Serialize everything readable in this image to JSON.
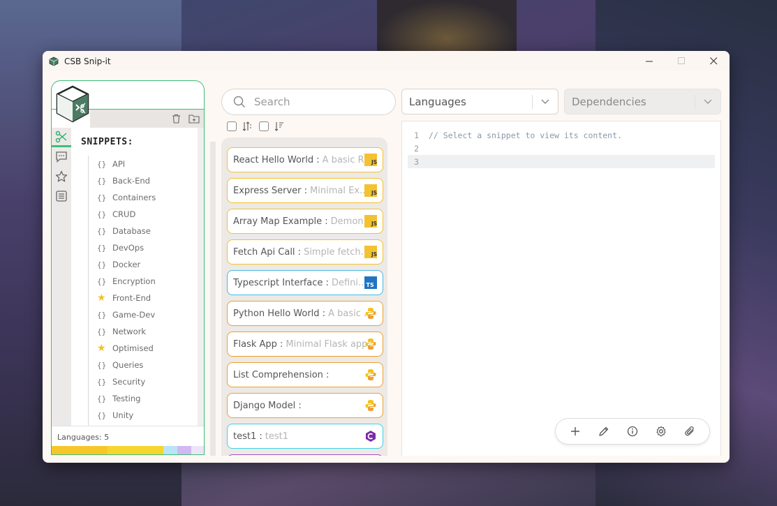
{
  "window": {
    "title": "CSB Snip-it",
    "controls": [
      "minimize",
      "maximize",
      "close"
    ]
  },
  "sidebar": {
    "heading": "SNIPPETS:",
    "toolbar": [
      "trash-icon",
      "add-folder-icon"
    ],
    "rail": [
      "scissors-icon",
      "comment-icon",
      "star-icon",
      "list-icon"
    ],
    "items": [
      {
        "label": "API",
        "icon": "braces"
      },
      {
        "label": "Back-End",
        "icon": "braces"
      },
      {
        "label": "Containers",
        "icon": "braces"
      },
      {
        "label": "CRUD",
        "icon": "braces"
      },
      {
        "label": "Database",
        "icon": "braces"
      },
      {
        "label": "DevOps",
        "icon": "braces"
      },
      {
        "label": "Docker",
        "icon": "braces"
      },
      {
        "label": "Encryption",
        "icon": "braces"
      },
      {
        "label": "Front-End",
        "icon": "star"
      },
      {
        "label": "Game-Dev",
        "icon": "braces"
      },
      {
        "label": "Network",
        "icon": "braces"
      },
      {
        "label": "Optimised",
        "icon": "star"
      },
      {
        "label": "Queries",
        "icon": "braces"
      },
      {
        "label": "Security",
        "icon": "braces"
      },
      {
        "label": "Testing",
        "icon": "braces"
      },
      {
        "label": "Unity",
        "icon": "braces"
      }
    ],
    "footer": "Languages: 5",
    "lang_colors": [
      "#f7c72a",
      "#f7d52f",
      "#b9e4f5",
      "#d2b8f0",
      "#ede4fa"
    ]
  },
  "search": {
    "placeholder": "Search"
  },
  "filters": {
    "languages_label": "Languages",
    "dependencies_label": "Dependencies"
  },
  "snippets": [
    {
      "title": "React Hello World",
      "desc": "A basic R...",
      "lang": "js"
    },
    {
      "title": "Express Server",
      "desc": "Minimal Ex...",
      "lang": "js"
    },
    {
      "title": "Array Map Example",
      "desc": "Demon...",
      "lang": "js"
    },
    {
      "title": "Fetch Api Call",
      "desc": "Simple fetch...",
      "lang": "js"
    },
    {
      "title": "Typescript Interface",
      "desc": "Defini...",
      "lang": "ts"
    },
    {
      "title": "Python Hello World",
      "desc": "A basic ...",
      "lang": "py"
    },
    {
      "title": "Flask App",
      "desc": "Minimal Flask app",
      "lang": "py"
    },
    {
      "title": "List Comprehension",
      "desc": "",
      "lang": "py"
    },
    {
      "title": "Django Model",
      "desc": "",
      "lang": "py"
    },
    {
      "title": "test1",
      "desc": "test1",
      "lang": "cs"
    }
  ],
  "editor": {
    "lines": [
      {
        "n": "1",
        "code": "// Select a snippet to view its content."
      },
      {
        "n": "2",
        "code": ""
      },
      {
        "n": "3",
        "code": ""
      }
    ],
    "toolbar": [
      "plus-icon",
      "pencil-icon",
      "info-icon",
      "gear-icon",
      "paperclip-icon"
    ]
  },
  "colors": {
    "accent_green": "#3cbf7a",
    "js": "#f2c230",
    "ts": "#1f74c4",
    "py": "#f0a030",
    "cs": "#7a2aa8"
  }
}
